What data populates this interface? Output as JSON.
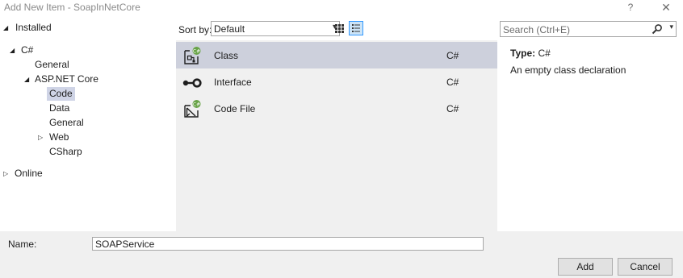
{
  "window": {
    "title": "Add New Item - SoapInNetCore",
    "help_glyph": "?",
    "close_glyph": "✕"
  },
  "tree": {
    "installed": "Installed",
    "csharp": "C#",
    "general": "General",
    "aspnet": "ASP.NET Core",
    "code": "Code",
    "data": "Data",
    "general2": "General",
    "web": "Web",
    "csharp2": "CSharp",
    "online": "Online"
  },
  "toolbar": {
    "sort_label": "Sort by:",
    "sort_value": "Default"
  },
  "search": {
    "placeholder": "Search (Ctrl+E)"
  },
  "items": [
    {
      "name": "Class",
      "lang": "C#",
      "icon": "class-icon"
    },
    {
      "name": "Interface",
      "lang": "C#",
      "icon": "interface-icon"
    },
    {
      "name": "Code File",
      "lang": "C#",
      "icon": "code-file-icon"
    }
  ],
  "info": {
    "type_key": "Type:",
    "type_value": "C#",
    "description": "An empty class declaration"
  },
  "footer": {
    "name_label": "Name:",
    "name_value": "SOAPService",
    "add_label": "Add",
    "cancel_label": "Cancel"
  },
  "colors": {
    "selected_row": "#cdd0dc",
    "list_bg": "#f0f0f0",
    "csharp_badge": "#68a347",
    "view_active": "#3399ff"
  }
}
